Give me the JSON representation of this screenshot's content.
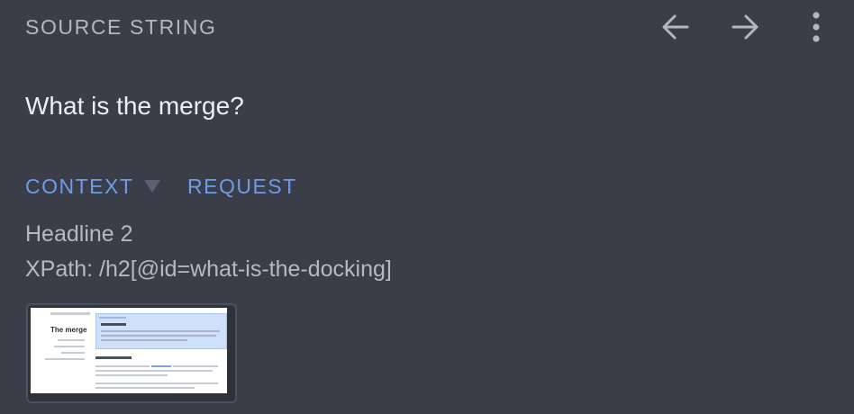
{
  "header": {
    "title": "SOURCE STRING",
    "icons": {
      "prev": "arrow-left-icon",
      "next": "arrow-right-icon",
      "more": "more-vertical-icon"
    }
  },
  "source": {
    "text": "What is the merge?"
  },
  "tabs": [
    {
      "label": "CONTEXT",
      "has_caret": true
    },
    {
      "label": "REQUEST",
      "has_caret": false
    }
  ],
  "context": {
    "type": "Headline 2",
    "xpath": "XPath: /h2[@id=what-is-the-docking]"
  },
  "screenshot_thumbnail": {
    "page_title": "The merge"
  },
  "colors": {
    "background": "#393e49",
    "label": "#b3b7bf",
    "accent": "#6f9be8",
    "text": "#eceef1"
  }
}
